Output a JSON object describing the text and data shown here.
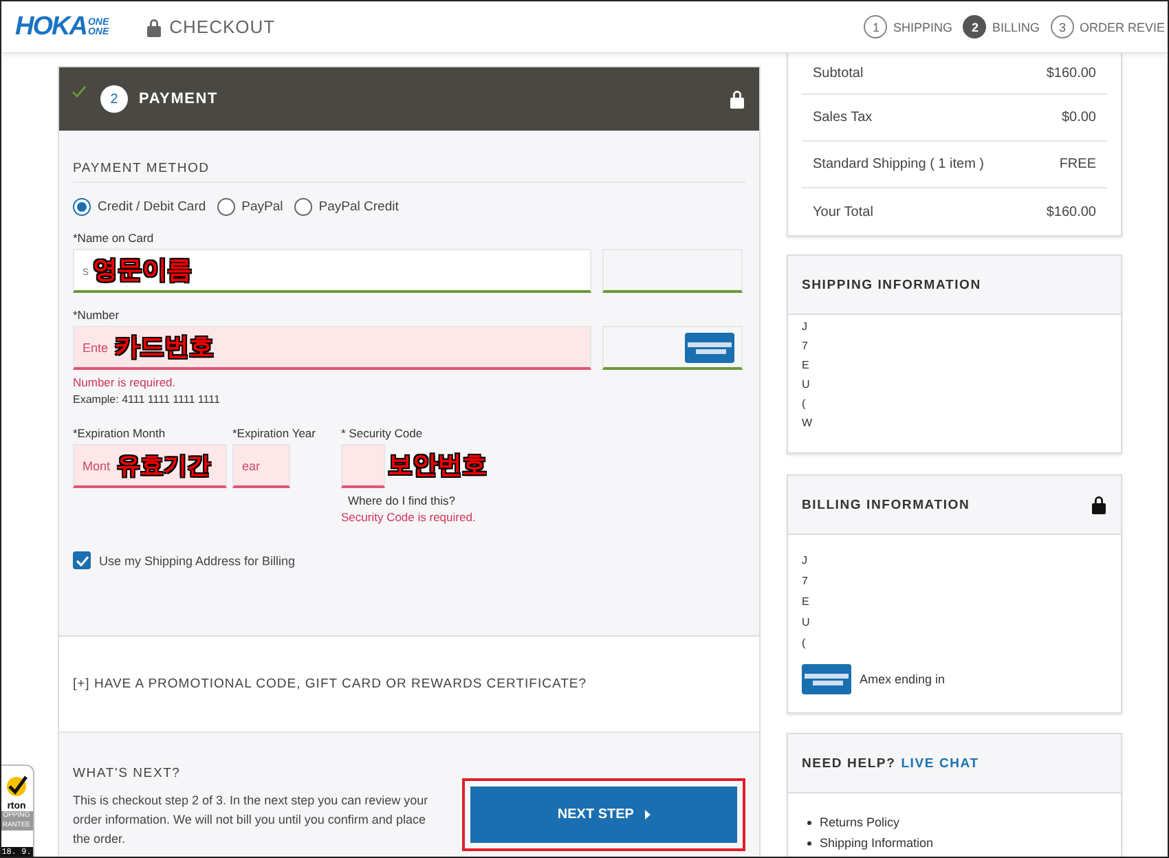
{
  "header": {
    "logo": {
      "wordmark": "HOKA",
      "sub": [
        "ONE",
        "ONE"
      ]
    },
    "title": "CHECKOUT",
    "steps": [
      {
        "number": "1",
        "label": "SHIPPING",
        "selected": false
      },
      {
        "number": "2",
        "label": "BILLING",
        "selected": true
      },
      {
        "number": "3",
        "label": "ORDER REVIE",
        "selected": false
      }
    ]
  },
  "payment": {
    "completed": true,
    "number": "2",
    "title": "PAYMENT",
    "section_title": "PAYMENT METHOD",
    "methods": [
      {
        "label": "Credit / Debit Card",
        "selected": true
      },
      {
        "label": "PayPal",
        "selected": false
      },
      {
        "label": "PayPal Credit",
        "selected": false
      }
    ],
    "name_field": {
      "label": "*Name on Card",
      "placeholder": "s",
      "error": false
    },
    "number_field": {
      "label": "*Number",
      "placeholder": "Ente",
      "error": true,
      "error_message": "Number is required.",
      "example": "Example: 4111 1111 1111 1111",
      "card_error": false
    },
    "expiry": [
      {
        "label": "*Expiration Month",
        "placeholder": "Mont",
        "error": true
      },
      {
        "label": "*Expiration Year",
        "placeholder": "ear",
        "error": true
      }
    ],
    "security": {
      "label": "* Security Code",
      "error": true,
      "help": "Where do I find this?",
      "error_message": "Security Code is required."
    },
    "same_address": {
      "label": "Use my Shipping Address for Billing",
      "checked": true
    },
    "promo": "[+] HAVE A PROMOTIONAL CODE, GIFT CARD OR REWARDS CERTIFICATE?",
    "whats_next": {
      "title": "WHAT'S NEXT?",
      "text": "This is checkout step 2 of 3. In the next step you can review your order information. We will not bill you until you confirm and place the order.",
      "button": "NEXT STEP",
      "highlighted": true
    }
  },
  "annotations": [
    {
      "text": "영문이름"
    },
    {
      "text": "카드번호"
    },
    {
      "text": "유효기간"
    },
    {
      "text": "보안번호"
    }
  ],
  "summary": [
    {
      "label": "Subtotal",
      "value": "$160.00"
    },
    {
      "label": "Sales Tax",
      "value": "$0.00"
    },
    {
      "label": "Standard Shipping ( 1 item )",
      "value": "FREE"
    },
    {
      "label": "Your Total",
      "value": "$160.00"
    }
  ],
  "shipping_info": {
    "title": "SHIPPING INFORMATION",
    "lines": [
      "J",
      "7",
      "E",
      "U",
      "(",
      "W"
    ]
  },
  "billing_info": {
    "title": "BILLING INFORMATION",
    "lines": [
      "J",
      "7",
      "E",
      "U",
      "("
    ],
    "card": "Amex ending in"
  },
  "help": {
    "title": "NEED HELP?",
    "link": "LIVE CHAT",
    "links": [
      "Returns Policy",
      "Shipping Information"
    ]
  },
  "badge": {
    "brand": "rton",
    "lines": [
      "OPPING",
      "RANTEE"
    ],
    "date": "18. 9."
  }
}
